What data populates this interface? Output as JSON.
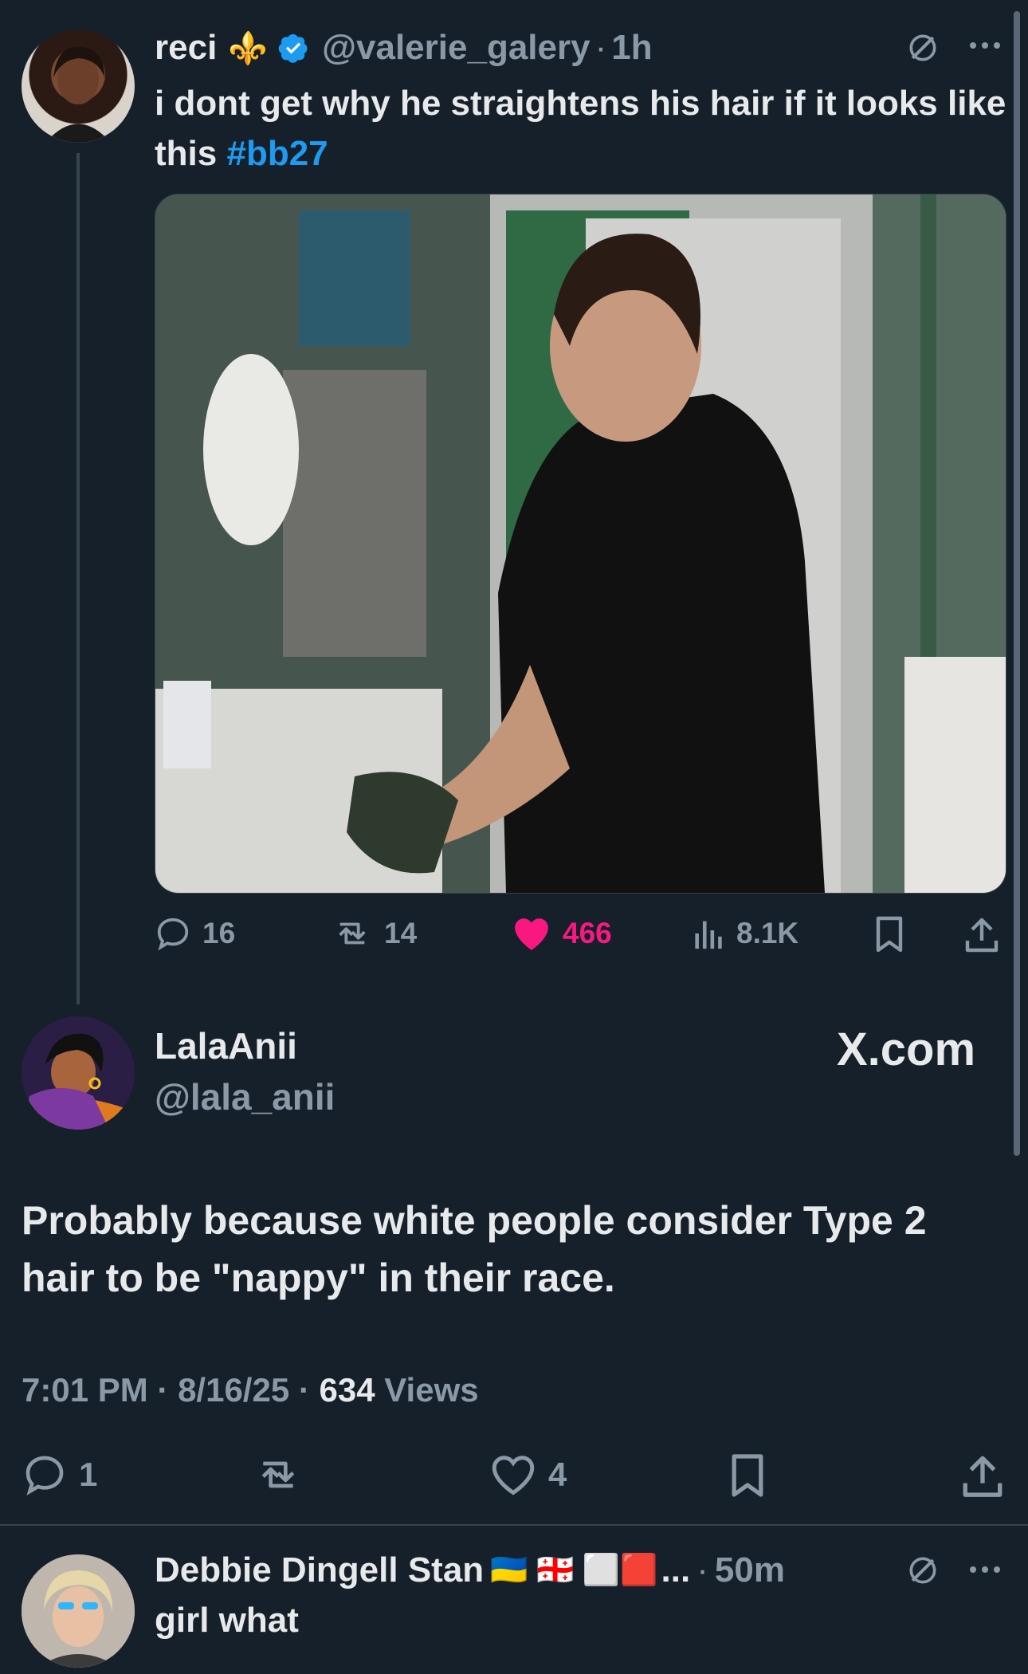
{
  "tweet1": {
    "display_name": "reci",
    "name_emoji": "⚜️",
    "handle": "@valerie_galery",
    "separator": "·",
    "time": "1h",
    "text": "i dont get why he straightens his hair if it looks like this",
    "hashtag": "#bb27",
    "replies": "16",
    "retweets": "14",
    "likes": "466",
    "views": "8.1K",
    "liked": true
  },
  "tweet2": {
    "display_name": "LalaAnii",
    "handle": "@lala_anii",
    "source": "X.com",
    "text": "Probably because white people consider Type 2 hair to be \"nappy\" in their race.",
    "time": "7:01 PM",
    "date": "8/16/25",
    "views_count": "634",
    "views_label": "Views",
    "replies": "1",
    "likes": "4"
  },
  "tweet3": {
    "display_name": "Debbie Dingell Stan",
    "name_emoji": "🇺🇦 🇬🇪 ⬜🟥",
    "ellipsis": "...",
    "time": "50m",
    "text": "girl what"
  },
  "colors": {
    "background": "#15202b",
    "text": "#e7e9ea",
    "muted": "#8b98a5",
    "accent": "#1d9bf0",
    "like": "#f91880"
  }
}
